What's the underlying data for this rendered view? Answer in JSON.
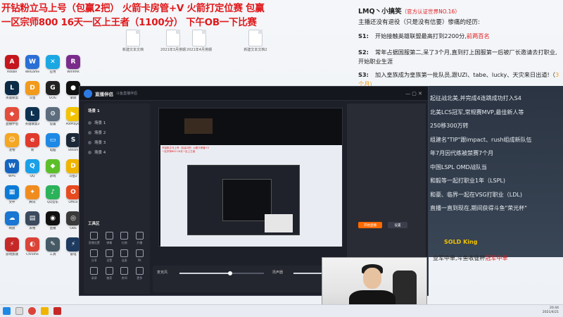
{
  "banner": {
    "line1": "开钻粉立马上号（包赢2把） 火箭卡房管+V  火箭打定位赛 包赢",
    "line2": "一区宗师800   16天一区上王者（1100分）  下午OB一下比赛"
  },
  "desktop_files": [
    "新建文本文档",
    "2021年3月排期",
    "2021年4月排期",
    "新建文本文档2"
  ],
  "desktop_icons": [
    {
      "label": "Adobe",
      "icon": "adobe-icon",
      "color": "#c4161c",
      "text": "A"
    },
    {
      "label": "WeGame",
      "icon": "wegame-icon",
      "color": "#2b6fd6",
      "text": "W"
    },
    {
      "label": "应用",
      "icon": "app-icon",
      "color": "#1aa7e2",
      "text": "✕"
    },
    {
      "label": "WinRAR",
      "icon": "winrar-icon",
      "color": "#7a2c8b",
      "text": "R"
    },
    {
      "label": "英雄联盟",
      "icon": "lol-icon",
      "color": "#0b2a45",
      "text": "L"
    },
    {
      "label": "斗鱼",
      "icon": "douyu-icon",
      "color": "#f29a1b",
      "text": "D"
    },
    {
      "label": "GOG",
      "icon": "gog-icon",
      "color": "#222222",
      "text": "G"
    },
    {
      "label": "录屏",
      "icon": "record-icon",
      "color": "#111111",
      "text": "●"
    },
    {
      "label": "直播伴侣",
      "icon": "live-icon",
      "color": "#e34d3c",
      "text": "◆"
    },
    {
      "label": "英雄联盟2",
      "icon": "lol2-icon",
      "color": "#0e3151",
      "text": "L"
    },
    {
      "label": "设置",
      "icon": "settings-icon",
      "color": "#5d6d7e",
      "text": "⚙"
    },
    {
      "label": "PotPlayer",
      "icon": "potplayer-icon",
      "color": "#f3c300",
      "text": "▶"
    },
    {
      "label": "宠物",
      "icon": "pet-icon",
      "color": "#f5a623",
      "text": "☺"
    },
    {
      "label": "易",
      "icon": "e-icon",
      "color": "#e03a2d",
      "text": "e"
    },
    {
      "label": "电脑",
      "icon": "pc-icon",
      "color": "#1e88e5",
      "text": "▭"
    },
    {
      "label": "Steam",
      "icon": "steam-icon",
      "color": "#1b2838",
      "text": "S"
    },
    {
      "label": "WPS",
      "icon": "wps-icon",
      "color": "#1565c0",
      "text": "W"
    },
    {
      "label": "QQ",
      "icon": "qq-icon",
      "color": "#1aa0e8",
      "text": "Q"
    },
    {
      "label": "游戏",
      "icon": "game-icon",
      "color": "#5cbf2a",
      "text": "◆"
    },
    {
      "label": "斗鱼2",
      "icon": "douyu2-icon",
      "color": "#f0b400",
      "text": "D"
    },
    {
      "label": "文件",
      "icon": "file-icon",
      "color": "#0b7bd8",
      "text": "▦"
    },
    {
      "label": "腾讯",
      "icon": "tencent-icon",
      "color": "#f08c1e",
      "text": "✦"
    },
    {
      "label": "QQ音乐",
      "icon": "music-icon",
      "color": "#2cb25a",
      "text": "♪"
    },
    {
      "label": "Office",
      "icon": "office-icon",
      "color": "#e84a1f",
      "text": "O"
    },
    {
      "label": "网盘",
      "icon": "cloud-icon",
      "color": "#1976d2",
      "text": "☁"
    },
    {
      "label": "表格",
      "icon": "sheet-icon",
      "color": "#3b4a5e",
      "text": "▤"
    },
    {
      "label": "直播",
      "icon": "stream-icon",
      "color": "#111111",
      "text": "◉"
    },
    {
      "label": "OBS",
      "icon": "obs-icon",
      "color": "#3a3a3a",
      "text": "◎"
    },
    {
      "label": "游戏加速",
      "icon": "speed-icon",
      "color": "#c62828",
      "text": "⚡"
    },
    {
      "label": "Chrome",
      "icon": "chrome-icon",
      "color": "#db4437",
      "text": "◐"
    },
    {
      "label": "工具",
      "icon": "tool-icon",
      "color": "#455a64",
      "text": "✎"
    },
    {
      "label": "雷电",
      "icon": "thunder-icon",
      "color": "#1e3a5f",
      "text": "⚡"
    }
  ],
  "right_panel": {
    "title": "LMQ丶小搞笑",
    "title_tag": "（官方认证世界NO.16）",
    "intro": "主播还没有退役（只是没有信要）惨痛的经历:",
    "items": [
      {
        "num": "S1:",
        "text": "开始接触英雄联盟最高打到2200分,",
        "hl": "前两百名"
      },
      {
        "num": "S2:",
        "text": "常年占据国服第二,呆了3个月,直到打上国服第一后被厂长邀请去打职业,开始职业生涯",
        "hl": ""
      },
      {
        "num": "S3:",
        "text": "加入皇族成为皇族第一批队员,跟UZI、tabe、lucky、天灾来日出道!（",
        "hl": "3个月)"
      }
    ],
    "mid_lines": [
      "起征战北美,并完成4连跳成功打入S4",
      "北美LCS冠军,常规赛MVP,最佳新人等",
      "250移300万转",
      "组建名\"TIP\"跟impact、rush组成新队伍",
      "年7月因代练被禁赛7个月",
      "中国LSPL OMD战队当",
      "和毅等一起打职业1年（LSPL)",
      "和豪、临界一起在VSG打职业（LDL)",
      "直播一直到现在,期间获得斗鱼\"荣光杯\""
    ],
    "sold": "SOLD King",
    "tail": "业军中单,斗鱼收徒杯",
    "tail_hl": "冠军中单"
  },
  "client": {
    "name": "直播伴侣",
    "subtitle": "斗鱼直播伴侣",
    "scenes": [
      "场景 1",
      "场景 2",
      "场景 3",
      "场景 4"
    ],
    "sources_title": "场景 1",
    "tools_title": "工具区",
    "tools": [
      "直播设置",
      "弹幕",
      "礼物",
      "开播",
      "分享",
      "设置",
      "连麦",
      "PK",
      "录屏",
      "抽奖",
      "房间",
      "更多"
    ],
    "bottom": {
      "mic": "麦克风",
      "speaker": "扬声器",
      "mic_level": 0.6,
      "speaker_level": 0.55
    },
    "right_buttons": {
      "primary": "开始直播",
      "secondary": "设置"
    }
  },
  "taskbar": {
    "time": "20:44",
    "date": "2021/4/21"
  }
}
